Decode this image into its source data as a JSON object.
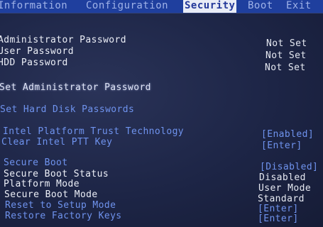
{
  "menu": {
    "tabs": [
      "Information",
      "Configuration",
      "Security",
      "Boot",
      "Exit"
    ],
    "active": "Security"
  },
  "passwords": [
    {
      "label": "Administrator Password",
      "value": "Not Set"
    },
    {
      "label": "User Password",
      "value": "Not Set"
    },
    {
      "label": "HDD Password",
      "value": "Not Set"
    }
  ],
  "actions": {
    "set_admin": "Set Administrator Password",
    "set_hdd": "Set Hard Disk Passwords"
  },
  "ptt": [
    {
      "label": "Intel Platform Trust Technology",
      "value": "[Enabled]"
    },
    {
      "label": "Clear Intel PTT Key",
      "value": "[Enter]"
    }
  ],
  "secure_boot": [
    {
      "label": "Secure Boot",
      "value": "[Disabled]"
    },
    {
      "label": "Secure Boot Status",
      "value": "Disabled"
    },
    {
      "label": "Platform Mode",
      "value": "User Mode"
    },
    {
      "label": "Secure Boot Mode",
      "value": "Standard"
    },
    {
      "label": "Reset to Setup Mode",
      "value": "[Enter]"
    },
    {
      "label": "Restore Factory Keys",
      "value": "[Enter]"
    }
  ]
}
